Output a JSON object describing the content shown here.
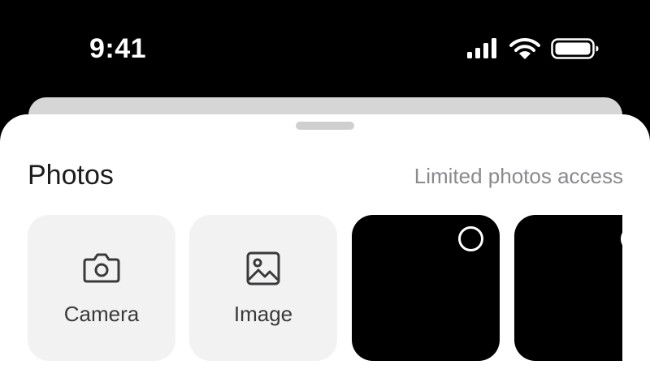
{
  "status_bar": {
    "time": "9:41",
    "icons": [
      "cellular-signal-icon",
      "wifi-icon",
      "battery-icon"
    ],
    "background": "#000000",
    "foreground": "#ffffff"
  },
  "sheet": {
    "title": "Photos",
    "access_link": "Limited photos access",
    "actions": [
      {
        "label": "Camera",
        "icon": "camera-icon"
      },
      {
        "label": "Image",
        "icon": "image-icon"
      }
    ],
    "photos": [
      {
        "selected": false
      },
      {
        "selected": false
      }
    ],
    "colors": {
      "title": "#1c1c1e",
      "link": "#8a8a8e",
      "tile_background": "#f2f2f2",
      "grabber": "#cfcfcf"
    }
  }
}
